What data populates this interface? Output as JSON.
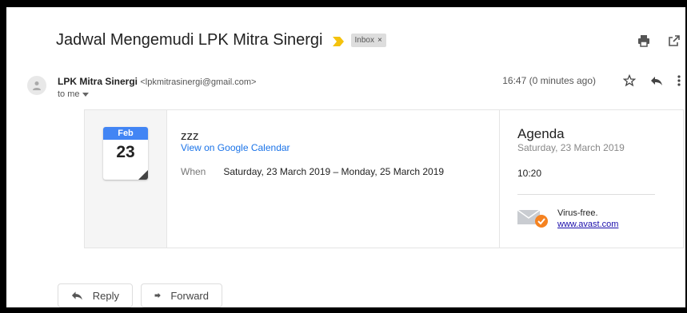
{
  "email": {
    "subject": "Jadwal Mengemudi LPK Mitra Sinergi",
    "label": "Inbox",
    "label_close": "×",
    "sender_name": "LPK Mitra Sinergi",
    "sender_email": "<lpkmitrasinergi@gmail.com>",
    "recipient": "to me",
    "timestamp": "16:47 (0 minutes ago)",
    "icons": {
      "print": "print-icon",
      "popout": "open-in-new-window-icon",
      "star": "star-icon",
      "reply": "reply-icon",
      "more": "more-vert-icon",
      "avatar": "person-icon",
      "important": "important-marker-icon"
    },
    "colors": {
      "important": "#f4c20d",
      "calendar_header": "#4285f4",
      "link": "#1a73e8",
      "avast_badge": "#f58220"
    }
  },
  "invite": {
    "month": "Feb",
    "day": "23",
    "title": "zzz",
    "calendar_link": "View on Google Calendar",
    "when_label": "When",
    "when_value": "Saturday, 23 March 2019 – Monday, 25 March 2019"
  },
  "agenda": {
    "title": "Agenda",
    "date": "Saturday, 23 March 2019",
    "time": "10:20"
  },
  "avast": {
    "label": "Virus-free.",
    "link": "www.avast.com"
  },
  "actions": {
    "reply": "Reply",
    "forward": "Forward"
  }
}
